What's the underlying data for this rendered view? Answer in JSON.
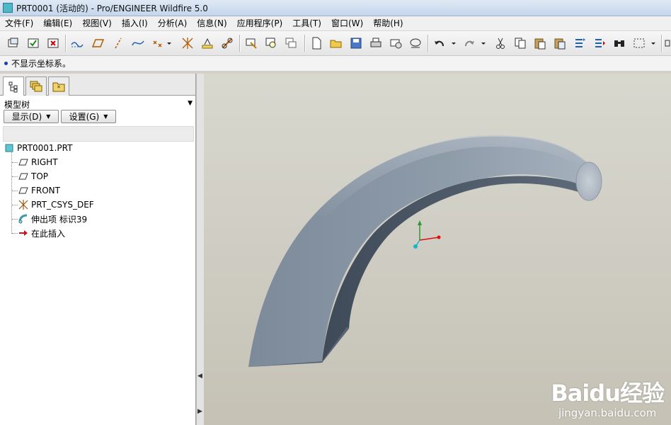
{
  "window": {
    "title": "PRT0001 (活动的) - Pro/ENGINEER Wildfire 5.0",
    "accent": "#4fb8c8"
  },
  "menu": [
    {
      "label": "文件(F)"
    },
    {
      "label": "编辑(E)"
    },
    {
      "label": "视图(V)"
    },
    {
      "label": "插入(I)"
    },
    {
      "label": "分析(A)"
    },
    {
      "label": "信息(N)"
    },
    {
      "label": "应用程序(P)"
    },
    {
      "label": "工具(T)"
    },
    {
      "label": "窗口(W)"
    },
    {
      "label": "帮助(H)"
    }
  ],
  "toolbar_icons": [
    "window-icon",
    "accept-icon",
    "close-window-icon",
    "datum-axis-display-icon",
    "datum-plane-display-icon",
    "axis-icon",
    "curve-icon",
    "point-icon",
    "csys-icon",
    "annotation-icon",
    "link-icon",
    "select-filter-icon",
    "zoom-fit-icon",
    "repaint-icon",
    "new-file-icon",
    "open-folder-icon",
    "save-icon",
    "print-icon",
    "email-icon",
    "send-icon",
    "undo-icon",
    "redo-icon",
    "cut-icon",
    "copy-icon",
    "paste-icon",
    "paste-special-icon",
    "regenerate-icon",
    "regenerate-manager-icon",
    "find-icon",
    "box-select-icon",
    "dropdown-icon"
  ],
  "message": {
    "text": "不显示坐标系。"
  },
  "panel": {
    "title": "模型树",
    "show_button": "显示(D)",
    "settings_button": "设置(G)",
    "tabs": [
      "model-tree-tab-icon",
      "layers-tab-icon",
      "favorites-tab-icon"
    ]
  },
  "tree": [
    {
      "label": "PRT0001.PRT",
      "icon": "part-icon"
    },
    {
      "label": "RIGHT",
      "icon": "datum-plane-icon"
    },
    {
      "label": "TOP",
      "icon": "datum-plane-icon"
    },
    {
      "label": "FRONT",
      "icon": "datum-plane-icon"
    },
    {
      "label": "PRT_CSYS_DEF",
      "icon": "csys-icon"
    },
    {
      "label": "伸出项 标识39",
      "icon": "sweep-protrusion-icon"
    },
    {
      "label": "在此插入",
      "icon": "insert-here-arrow-icon"
    }
  ],
  "watermark": {
    "logo": "Baidu经验",
    "url": "jingyan.baidu.com"
  }
}
